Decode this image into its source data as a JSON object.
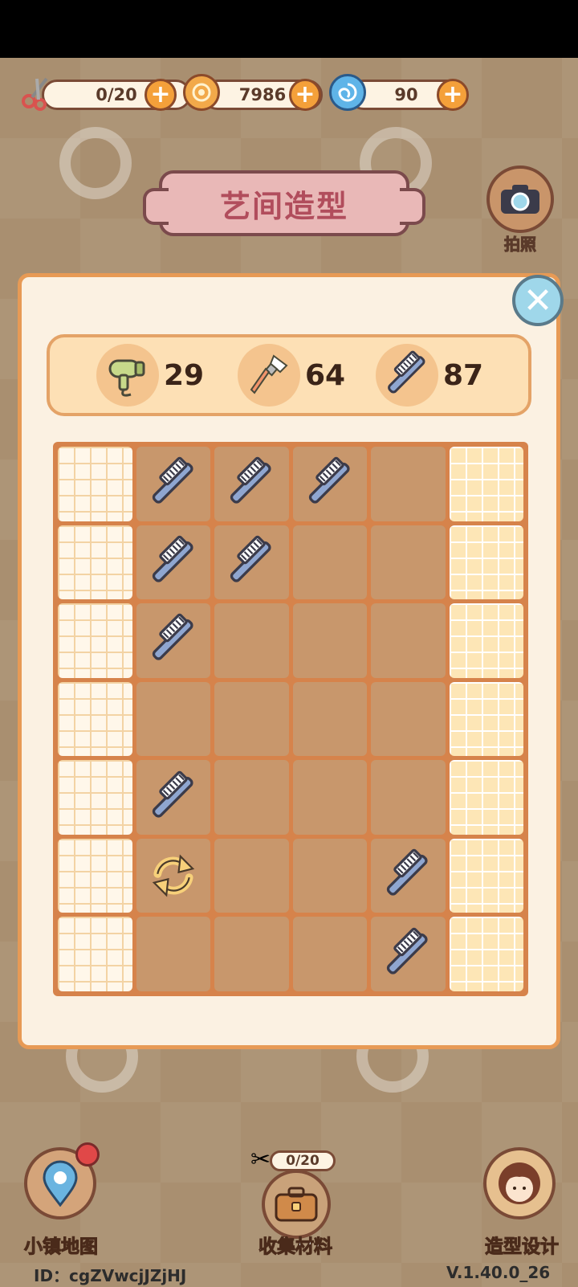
{
  "resources": {
    "scissors": {
      "value": "0/20",
      "icon": "scissors-icon"
    },
    "coins": {
      "value": "7986",
      "icon": "coin-icon"
    },
    "swirl": {
      "value": "90",
      "icon": "swirl-icon"
    }
  },
  "title": "艺间造型",
  "camera": {
    "label": "拍照"
  },
  "tools": [
    {
      "name": "hair-dryer",
      "icon": "hair-dryer-icon",
      "count": "29"
    },
    {
      "name": "makeup-brush",
      "icon": "makeup-brush-icon",
      "count": "64"
    },
    {
      "name": "comb",
      "icon": "comb-icon",
      "count": "87"
    }
  ],
  "grid": {
    "rows": [
      [
        "",
        "comb",
        "comb",
        "comb",
        "",
        ""
      ],
      [
        "",
        "comb",
        "comb",
        "",
        "",
        ""
      ],
      [
        "",
        "comb",
        "",
        "",
        "",
        ""
      ],
      [
        "",
        "",
        "",
        "",
        "",
        ""
      ],
      [
        "",
        "comb",
        "",
        "",
        "",
        ""
      ],
      [
        "",
        "refresh",
        "",
        "",
        "comb",
        ""
      ],
      [
        "",
        "",
        "",
        "",
        "comb",
        ""
      ]
    ]
  },
  "bottom": {
    "map_label": "小镇地图",
    "collect_label": "收集材料",
    "collect_counter": "0/20",
    "design_label": "造型设计"
  },
  "footer": {
    "id": "ID：cgZVwcjJZjHJ",
    "version": "V.1.40.0_26"
  },
  "colors": {
    "accent": "#e79a55",
    "plus": "#f4a03a",
    "title": "#b14d5c"
  }
}
